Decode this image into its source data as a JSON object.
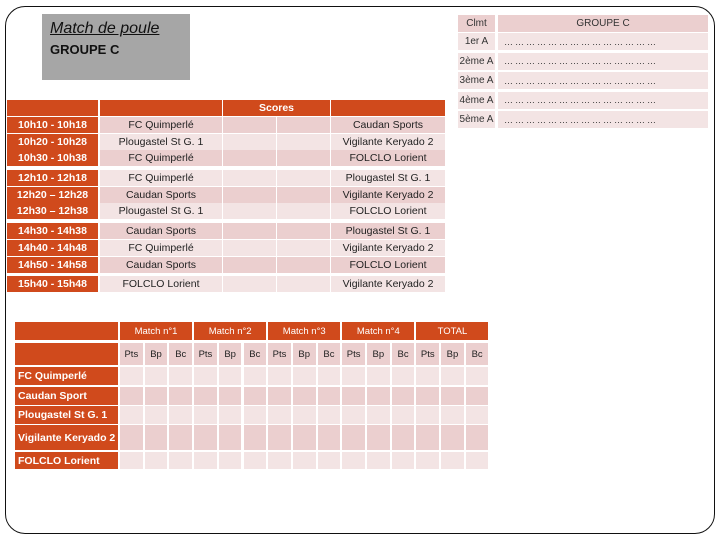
{
  "title": {
    "heading": "Match de poule",
    "group": "GROUPE C"
  },
  "ranking": {
    "col_rank": "Clmt",
    "col_group": "GROUPE C",
    "rows": [
      {
        "rank": "1er A",
        "value": "……………………………………"
      },
      {
        "rank": "2ème A",
        "value": "……………………………………"
      },
      {
        "rank": "3ème A",
        "value": "……………………………………"
      },
      {
        "rank": "4ème A",
        "value": "……………………………………"
      },
      {
        "rank": "5ème A",
        "value": "……………………………………"
      }
    ]
  },
  "schedule": {
    "scores_label": "Scores",
    "matches": [
      {
        "time": "10h10 - 10h18",
        "home": "FC Quimperlé",
        "away": "Caudan Sports"
      },
      {
        "time": "10h20 - 10h28",
        "home": "Plougastel St G. 1",
        "away": "Vigilante Keryado 2"
      },
      {
        "time": "10h30 - 10h38",
        "home": "FC Quimperlé",
        "away": "FOLCLO Lorient"
      },
      {
        "time": "12h10 - 12h18",
        "home": "FC Quimperlé",
        "away": "Plougastel St G. 1"
      },
      {
        "time": "12h20 – 12h28",
        "home": "Caudan Sports",
        "away": "Vigilante Keryado 2"
      },
      {
        "time": "12h30 – 12h38",
        "home": "Plougastel St G. 1",
        "away": "FOLCLO Lorient"
      },
      {
        "time": "14h30 - 14h38",
        "home": "Caudan Sports",
        "away": "Plougastel St G. 1"
      },
      {
        "time": "14h40 - 14h48",
        "home": "FC Quimperlé",
        "away": "Vigilante Keryado 2"
      },
      {
        "time": "14h50 - 14h58",
        "home": "Caudan Sports",
        "away": "FOLCLO Lorient"
      },
      {
        "time": "15h40 - 15h48",
        "home": "FOLCLO Lorient",
        "away": "Vigilante Keryado 2"
      }
    ]
  },
  "standings": {
    "groups": [
      "Match n°1",
      "Match n°2",
      "Match n°3",
      "Match n°4",
      "TOTAL"
    ],
    "subcols": [
      "Pts",
      "Bp",
      "Bc",
      "Pts",
      "Bp",
      "Bc",
      "Pts",
      "Bp",
      "Bc",
      "Pts",
      "Bp",
      "Bc",
      "Pts",
      "Bp",
      "Bc"
    ],
    "teams": [
      "FC Quimperlé",
      "Caudan Sport",
      "Plougastel St G. 1",
      "Vigilante Keryado 2",
      "FOLCLO Lorient"
    ]
  },
  "colors": {
    "accent": "#d04a1c",
    "cell_dark": "#ebcfcf",
    "cell_light": "#f3e4e4",
    "title_box": "#a6a6a6"
  }
}
